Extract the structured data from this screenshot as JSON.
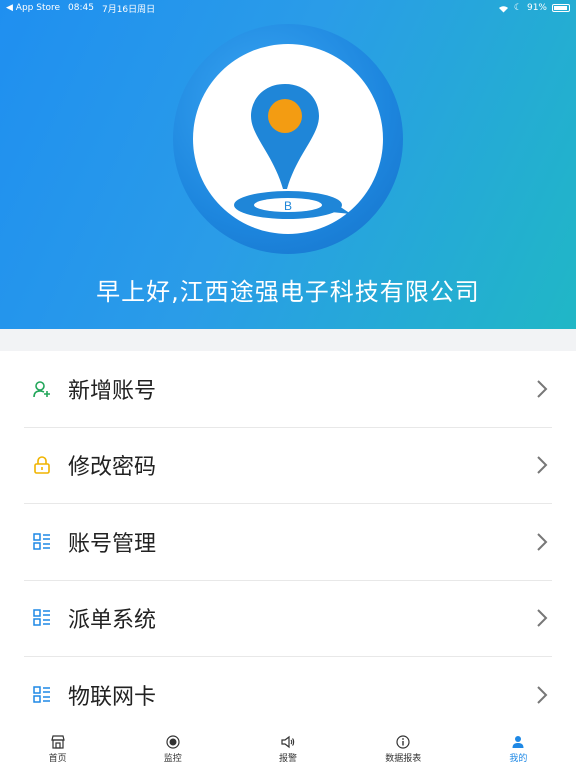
{
  "status": {
    "back_app": "App Store",
    "time": "08:45",
    "date": "7月16日周日",
    "battery": "91%"
  },
  "header": {
    "greeting": "早上好,江西途强电子科技有限公司"
  },
  "menu": {
    "items": [
      {
        "label": "新增账号",
        "icon": "add-user-icon",
        "color": "#22a65a"
      },
      {
        "label": "修改密码",
        "icon": "lock-icon",
        "color": "#f0b400"
      },
      {
        "label": "账号管理",
        "icon": "list-icon",
        "color": "#1e88e5"
      },
      {
        "label": "派单系统",
        "icon": "list-icon",
        "color": "#1e88e5"
      },
      {
        "label": "物联网卡",
        "icon": "list-icon",
        "color": "#1e88e5"
      }
    ]
  },
  "tabs": [
    {
      "label": "首页",
      "icon": "store-icon"
    },
    {
      "label": "监控",
      "icon": "target-icon"
    },
    {
      "label": "报警",
      "icon": "speaker-icon"
    },
    {
      "label": "数据报表",
      "icon": "info-icon"
    },
    {
      "label": "我的",
      "icon": "person-icon",
      "active": true
    }
  ],
  "colors": {
    "accent": "#1e88e5",
    "header_start": "#1f8ff0",
    "header_end": "#20b7c6"
  }
}
